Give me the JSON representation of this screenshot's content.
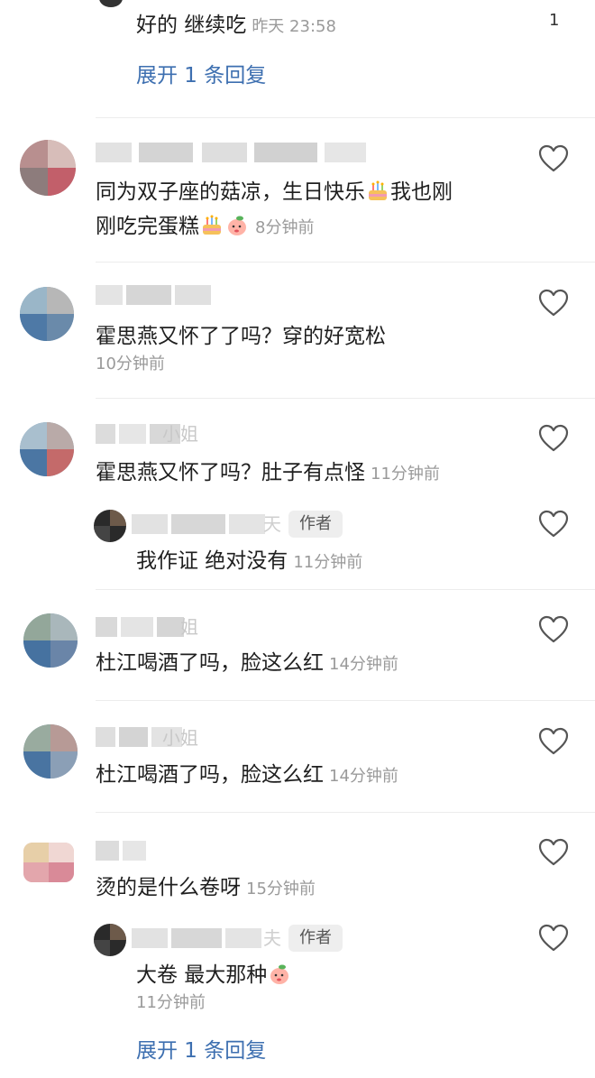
{
  "top": {
    "reply_text": "好的 继续吃",
    "reply_time": "昨天 23:58",
    "like_count": "1",
    "expand_label": "展开 1 条回复"
  },
  "comments": [
    {
      "text_line1": "同为双子座的菇凉，生日快乐",
      "text_line1b": "我也刚",
      "text_line2": "刚吃完蛋糕",
      "time": "8分钟前"
    },
    {
      "text": "霍思燕又怀了了吗？穿的好宽松",
      "time": "10分钟前"
    },
    {
      "text": "霍思燕又怀了吗？肚子有点怪",
      "time": "11分钟前",
      "reply": {
        "author_tag": "作者",
        "text": "我作证 绝对没有",
        "time": "11分钟前"
      }
    },
    {
      "text": "杜江喝酒了吗，脸这么红",
      "time": "14分钟前"
    },
    {
      "text": "杜江喝酒了吗，脸这么红",
      "time": "14分钟前"
    },
    {
      "text": "烫的是什么卷呀",
      "time": "15分钟前",
      "reply": {
        "author_tag": "作者",
        "text": "大卷 最大那种",
        "time": "11分钟前"
      },
      "expand_label": "展开 1 条回复"
    }
  ],
  "name_fragments": {
    "c3": "小姐",
    "c3_reply": "天",
    "c4": "姐",
    "c5": "小姐",
    "c6_reply": "夫"
  },
  "icons": {
    "like": "heart-outline-icon",
    "cake": "birthday-cake-emoji",
    "peach": "peach-face-emoji"
  },
  "colors": {
    "link": "#3d6fb0",
    "meta": "#9a9a9a",
    "divider": "#ececec",
    "tag_bg": "#eeeeee"
  }
}
